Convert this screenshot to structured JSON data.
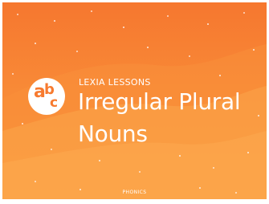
{
  "card": {
    "brand_label": "LEXIA LESSONS",
    "title": "Irregular Plural Nouns",
    "footer_label": "PHONICS"
  },
  "logo": {
    "letters": [
      "a",
      "b",
      "c"
    ],
    "icon": "abc-logo-icon"
  },
  "colors": {
    "background_top": "#f6772f",
    "background_bottom": "#fb9a3b",
    "wave": "#fba64a",
    "text": "#ffffff",
    "logo_fill": "#ffffff",
    "logo_letters": "#f77a2f"
  }
}
